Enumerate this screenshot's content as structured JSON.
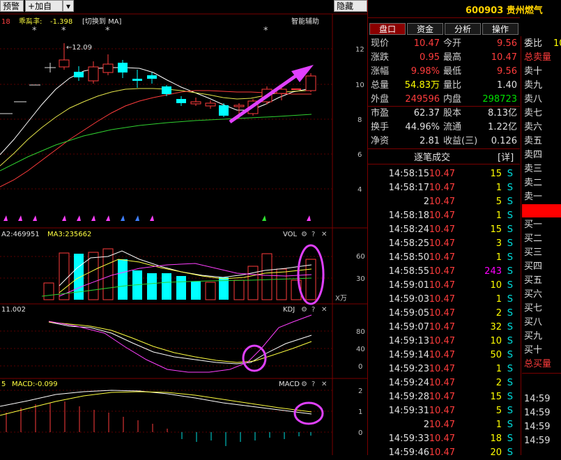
{
  "toolbar": {
    "alert_label": "预警",
    "add_watch_label": "加自选",
    "hide_label": "隐藏>>"
  },
  "main_panel": {
    "period_num": "18",
    "indicator_name": "乖离率:",
    "indicator_value": "-1.398",
    "switch_label": "[切换到 MA]",
    "assist_label": "智能辅助",
    "high_price_label": "12.09",
    "price_ticks": [
      "12",
      "10",
      "8",
      "6",
      "4"
    ]
  },
  "vol_panel": {
    "a2_label": "A2:469951",
    "ma3_label": "MA3:235662",
    "title": "VOL",
    "unit": "X万",
    "ticks": [
      "60",
      "30"
    ]
  },
  "kdj_panel": {
    "value_label": "11.002",
    "title": "KDJ",
    "ticks": [
      "80",
      "40",
      "0"
    ]
  },
  "macd_panel": {
    "period_label": "5",
    "value_label": "MACD:-0.099",
    "title": "MACD",
    "ticks": [
      "2",
      "1",
      "0"
    ]
  },
  "stock": {
    "code_name": "600903 贵州燃气"
  },
  "tabs": [
    "盘口",
    "资金",
    "分析",
    "操作"
  ],
  "quote": [
    {
      "l1": "现价",
      "v1": "10.47",
      "c1": "red",
      "l2": "今开",
      "v2": "9.56",
      "c2": "red"
    },
    {
      "l1": "涨跌",
      "v1": "0.95",
      "c1": "red",
      "l2": "最高",
      "v2": "10.47",
      "c2": "red"
    },
    {
      "l1": "涨幅",
      "v1": "9.98%",
      "c1": "red",
      "l2": "最低",
      "v2": "9.56",
      "c2": "red"
    },
    {
      "l1": "总量",
      "v1": "54.83万",
      "c1": "yellow",
      "l2": "量比",
      "v2": "1.40",
      "c2": "white"
    },
    {
      "l1": "外盘",
      "v1": "249596",
      "c1": "red",
      "l2": "内盘",
      "v2": "298723",
      "c2": "green"
    },
    {
      "l1": "市盈",
      "v1": "62.37",
      "c1": "white",
      "l2": "股本",
      "v2": "8.13亿",
      "c2": "white"
    },
    {
      "l1": "换手",
      "v1": "44.96%",
      "c1": "white",
      "l2": "流通",
      "v2": "1.22亿",
      "c2": "white"
    },
    {
      "l1": "净资",
      "v1": "2.81",
      "c1": "white",
      "l2": "收益(三)",
      "v2": "0.126",
      "c2": "white"
    }
  ],
  "trades_header": {
    "title": "逐笔成交",
    "detail": "[详]"
  },
  "trades": [
    {
      "t": "14:58:15",
      "p": "10.47",
      "v": "15",
      "vc": "yellow",
      "s": "S"
    },
    {
      "t": "14:58:17",
      "p": "10.47",
      "v": "1",
      "vc": "yellow",
      "s": "S"
    },
    {
      "t": "2",
      "p": "10.47",
      "v": "5",
      "vc": "yellow",
      "s": "S"
    },
    {
      "t": "14:58:18",
      "p": "10.47",
      "v": "1",
      "vc": "yellow",
      "s": "S"
    },
    {
      "t": "14:58:24",
      "p": "10.47",
      "v": "15",
      "vc": "yellow",
      "s": "S"
    },
    {
      "t": "14:58:25",
      "p": "10.47",
      "v": "3",
      "vc": "yellow",
      "s": "S"
    },
    {
      "t": "14:58:50",
      "p": "10.47",
      "v": "1",
      "vc": "yellow",
      "s": "S"
    },
    {
      "t": "14:58:55",
      "p": "10.47",
      "v": "243",
      "vc": "mag",
      "s": "S"
    },
    {
      "t": "14:59:01",
      "p": "10.47",
      "v": "10",
      "vc": "yellow",
      "s": "S"
    },
    {
      "t": "14:59:03",
      "p": "10.47",
      "v": "1",
      "vc": "yellow",
      "s": "S"
    },
    {
      "t": "14:59:05",
      "p": "10.47",
      "v": "2",
      "vc": "yellow",
      "s": "S"
    },
    {
      "t": "14:59:07",
      "p": "10.47",
      "v": "32",
      "vc": "yellow",
      "s": "S"
    },
    {
      "t": "14:59:13",
      "p": "10.47",
      "v": "10",
      "vc": "yellow",
      "s": "S"
    },
    {
      "t": "14:59:14",
      "p": "10.47",
      "v": "50",
      "vc": "yellow",
      "s": "S"
    },
    {
      "t": "14:59:23",
      "p": "10.47",
      "v": "1",
      "vc": "yellow",
      "s": "S"
    },
    {
      "t": "14:59:24",
      "p": "10.47",
      "v": "2",
      "vc": "yellow",
      "s": "S"
    },
    {
      "t": "14:59:28",
      "p": "10.47",
      "v": "15",
      "vc": "yellow",
      "s": "S"
    },
    {
      "t": "14:59:31",
      "p": "10.47",
      "v": "5",
      "vc": "yellow",
      "s": "S"
    },
    {
      "t": "2",
      "p": "10.47",
      "v": "1",
      "vc": "yellow",
      "s": "S"
    },
    {
      "t": "14:59:33",
      "p": "10.47",
      "v": "18",
      "vc": "yellow",
      "s": "S"
    },
    {
      "t": "14:59:46",
      "p": "10.47",
      "v": "20",
      "vc": "yellow",
      "s": "S"
    }
  ],
  "orderbook": {
    "top_label": "委比",
    "top_value": "10",
    "sell_total": "总卖量",
    "sells": [
      "卖十",
      "卖九",
      "卖八",
      "卖七",
      "卖六",
      "卖五",
      "卖四",
      "卖三",
      "卖二",
      "卖一"
    ],
    "buys": [
      "买一",
      "买二",
      "买三",
      "买四",
      "买五",
      "买六",
      "买七",
      "买八",
      "买九",
      "买十"
    ],
    "buy_total": "总买量",
    "times": [
      "14:59",
      "14:59",
      "14:59",
      "14:59"
    ]
  }
}
